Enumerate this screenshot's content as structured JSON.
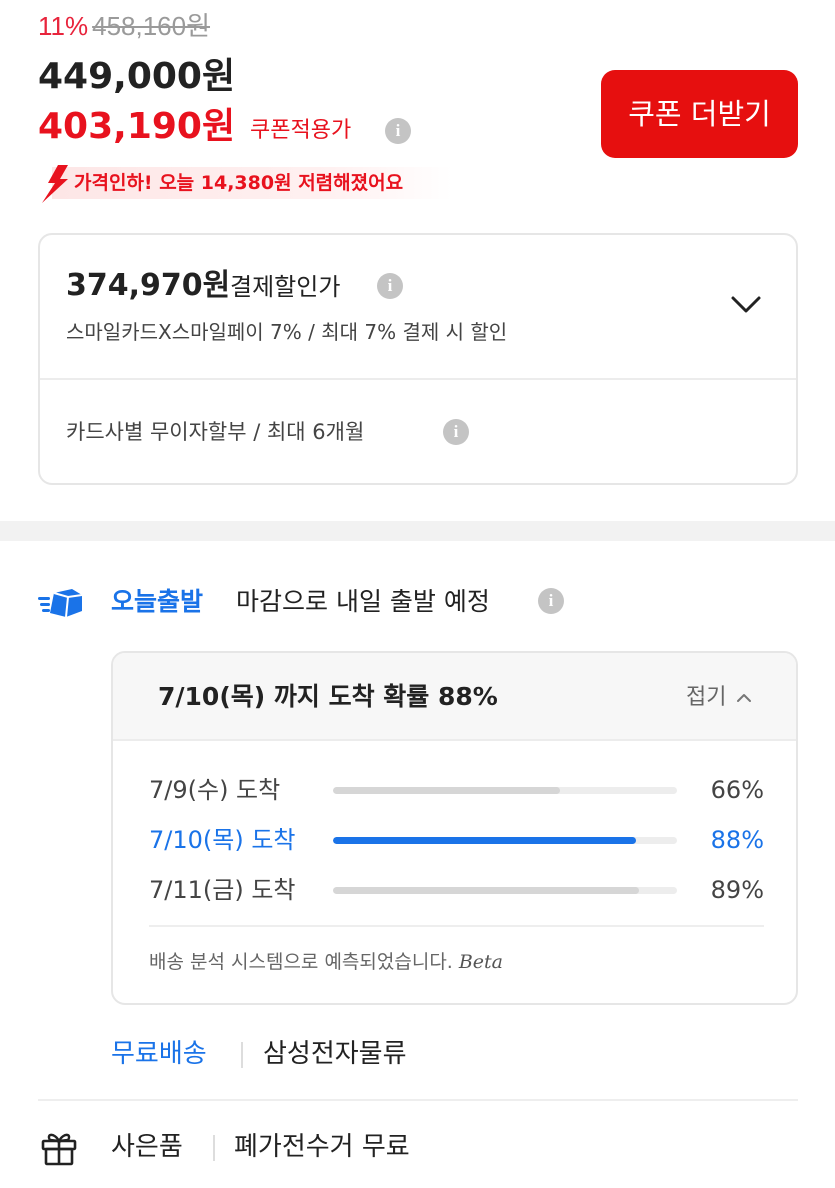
{
  "price": {
    "discount_rate": "11%",
    "original_price": "458,160원",
    "sale_price": "449,000원",
    "coupon_price": "403,190원",
    "coupon_label": "쿠폰적용가",
    "coupon_button": "쿠폰 더받기",
    "price_drop_text": "가격인하! 오늘 14,380원 저렴해졌어요"
  },
  "payment": {
    "price": "374,970원",
    "label": "결제할인가",
    "sub": "스마일카드X스마일페이 7% / 최대 7% 결제 시 할인",
    "installment": "카드사별 무이자할부 / 최대 6개월"
  },
  "today_departure": {
    "brand": "오늘출발",
    "text": "마감으로 내일 출발 예정"
  },
  "arrival": {
    "title": "7/10(목) 까지 도착 확률 88%",
    "fold_label": "접기",
    "rows": [
      {
        "label": "7/9(수) 도착",
        "percent": "66%",
        "fill": 0.66,
        "selected": false
      },
      {
        "label": "7/10(목) 도착",
        "percent": "88%",
        "fill": 0.88,
        "selected": true
      },
      {
        "label": "7/11(금) 도착",
        "percent": "89%",
        "fill": 0.89,
        "selected": false
      }
    ],
    "note": "배송 분석 시스템으로 예측되었습니다.",
    "beta": "Beta"
  },
  "shipping": {
    "free_label": "무료배송",
    "carrier": "삼성전자물류"
  },
  "gift": {
    "label": "사은품",
    "value": "폐가전수거 무료"
  },
  "colors": {
    "accent_red": "#e8121e",
    "accent_blue": "#1a73e8"
  },
  "icons": [
    "info-icon",
    "chevron-down-icon",
    "chevron-up-icon",
    "truck-icon",
    "gift-icon",
    "price-drop-arrow-icon"
  ]
}
